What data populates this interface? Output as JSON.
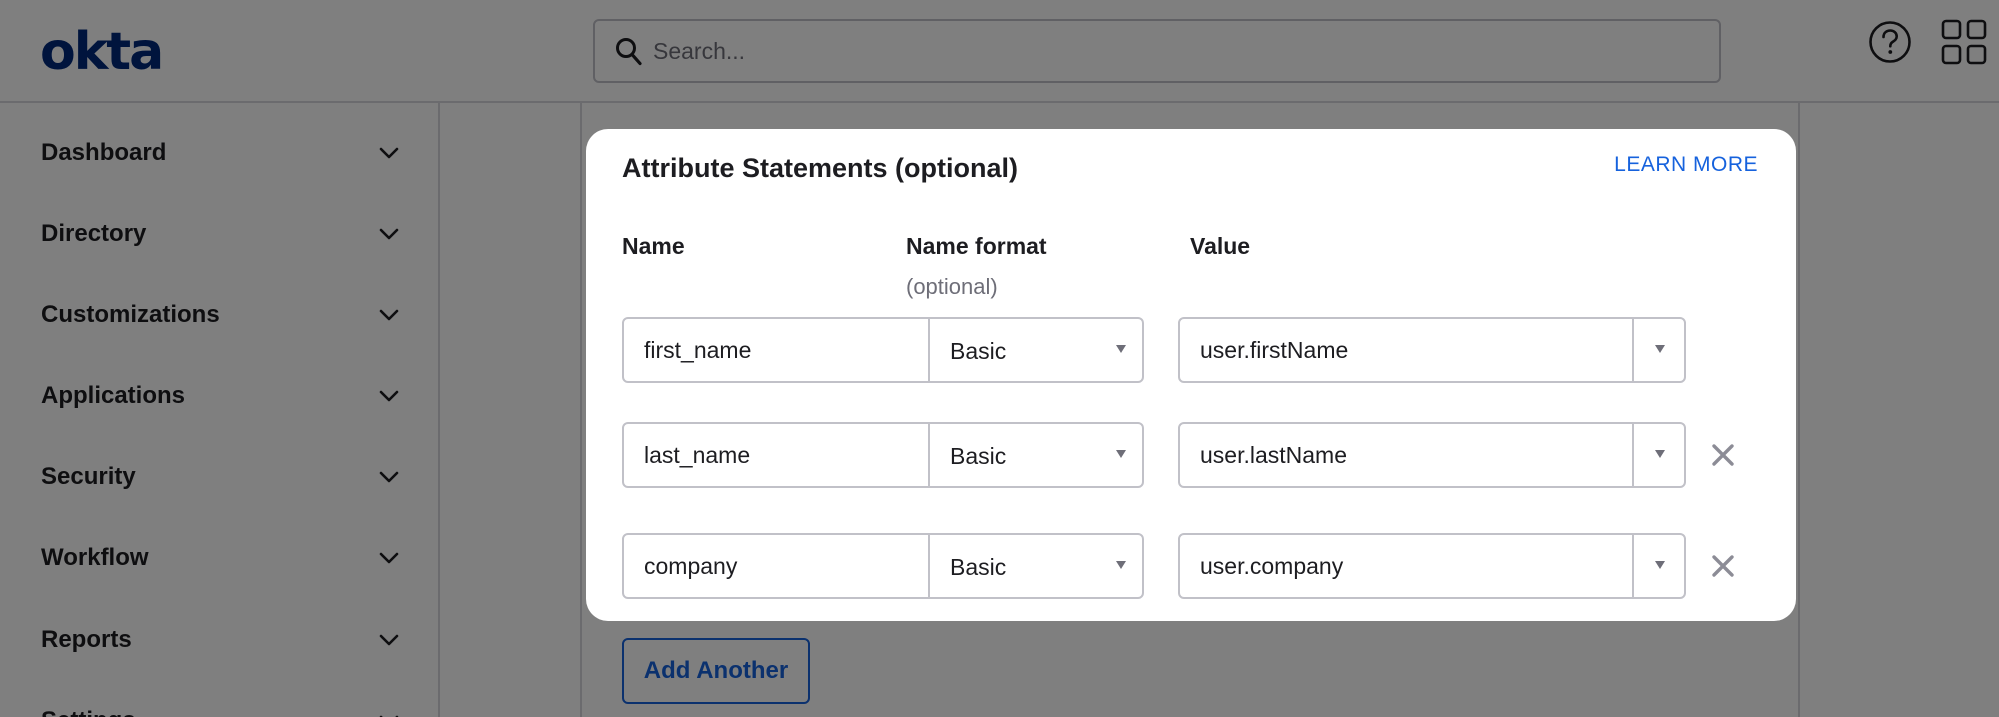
{
  "header": {
    "logo_text": "okta",
    "search_placeholder": "Search...",
    "help_icon": "help-circle-icon",
    "apps_icon": "grid-apps-icon"
  },
  "sidebar": {
    "items": [
      {
        "label": "Dashboard"
      },
      {
        "label": "Directory"
      },
      {
        "label": "Customizations"
      },
      {
        "label": "Applications"
      },
      {
        "label": "Security"
      },
      {
        "label": "Workflow"
      },
      {
        "label": "Reports"
      },
      {
        "label": "Settings"
      }
    ]
  },
  "main": {
    "add_another_label": "Add Another"
  },
  "modal": {
    "title": "Attribute Statements (optional)",
    "learn_more": "LEARN MORE",
    "columns": {
      "name": "Name",
      "name_format": "Name format",
      "name_format_sub": "(optional)",
      "value": "Value"
    },
    "rows": [
      {
        "name": "first_name",
        "format": "Basic",
        "value": "user.firstName",
        "removable": false
      },
      {
        "name": "last_name",
        "format": "Basic",
        "value": "user.lastName",
        "removable": true
      },
      {
        "name": "company",
        "format": "Basic",
        "value": "user.company",
        "removable": true
      }
    ]
  },
  "colors": {
    "brand": "#00297a",
    "link": "#1662dd",
    "overlay": "rgba(0,0,0,0.5)"
  }
}
